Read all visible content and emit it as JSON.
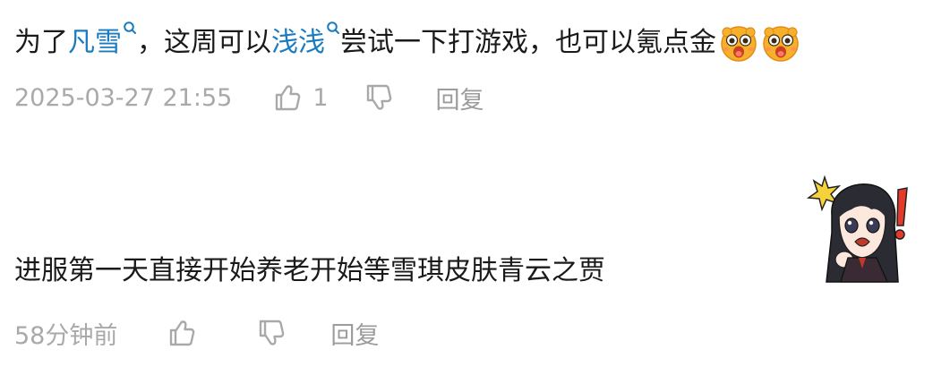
{
  "comments": [
    {
      "text_parts": {
        "p1": "为了",
        "link1": "凡雪",
        "p2": "，这周可以",
        "link2": "浅浅",
        "p3": "尝试一下打游戏，也可以氪点金"
      },
      "emojis": [
        "shocked-face-emoji",
        "shocked-face-emoji"
      ],
      "time": "2025-03-27 21:55",
      "likes": "1",
      "reply_label": "回复"
    },
    {
      "text": "进服第一天直接开始养老开始等雪琪皮肤青云之贾",
      "sticker": "chibi-girl-exclamation-sticker",
      "time": "58分钟前",
      "likes": "",
      "reply_label": "回复"
    }
  ],
  "colors": {
    "text": "#1a1a1a",
    "link": "#1a7bc0",
    "meta": "#a9a9a9"
  }
}
